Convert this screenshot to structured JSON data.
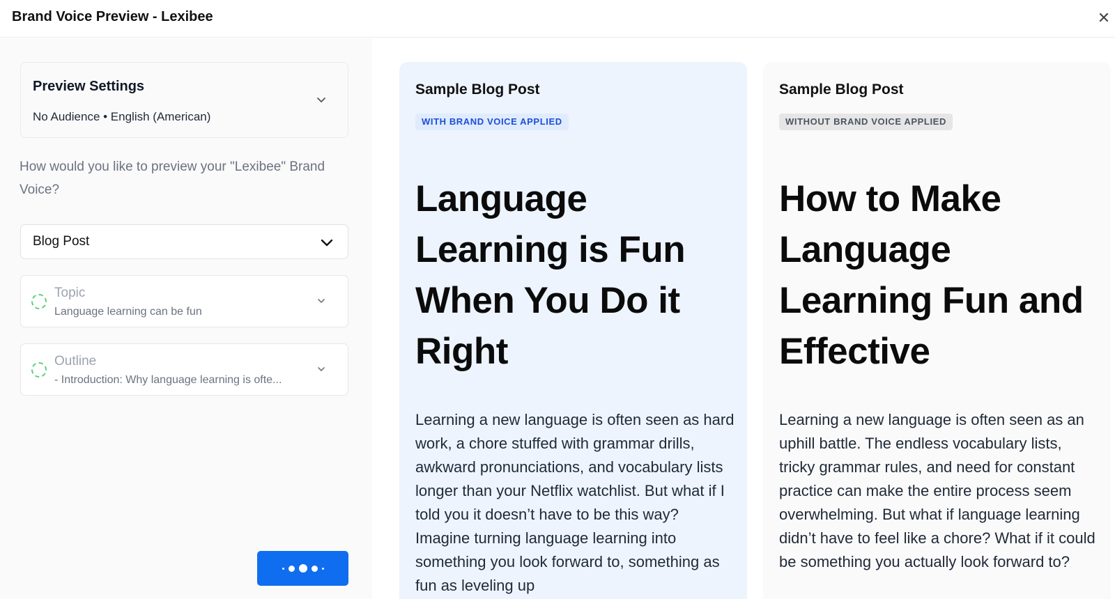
{
  "window": {
    "title": "Brand Voice Preview - Lexibee",
    "close_icon": "close-icon"
  },
  "settings": {
    "title": "Preview Settings",
    "summary": "No Audience • English (American)",
    "chevron_icon": "chevron-down-icon"
  },
  "question": "How would you like to preview your \"Lexibee\" Brand Voice?",
  "content_type": {
    "selected": "Blog Post",
    "chevron_icon": "chevron-down-icon"
  },
  "fields": {
    "topic": {
      "label": "Topic",
      "value": "Language learning can be fun",
      "status_icon": "loading-spinner-icon"
    },
    "outline": {
      "label": "Outline",
      "value": "- Introduction: Why language learning is ofte...",
      "status_icon": "loading-spinner-icon"
    }
  },
  "generate_button": {
    "state": "loading",
    "icon": "loading-dots-icon"
  },
  "preview_with": {
    "title": "Sample Blog Post",
    "badge": "WITH BRAND VOICE APPLIED",
    "headline": "Language Learning is Fun When You Do it Right",
    "body": "Learning a new language is often seen as hard work, a chore stuffed with grammar drills, awkward pronunciations, and vocabulary lists longer than your Netflix watchlist. But what if I told you it doesn’t have to be this way? Imagine turning language learning into something you look forward to, something as fun as leveling up"
  },
  "preview_without": {
    "title": "Sample Blog Post",
    "badge": "WITHOUT BRAND VOICE APPLIED",
    "headline": "How to Make Language Learning Fun and Effective",
    "body": "Learning a new language is often seen as an uphill battle. The endless vocabulary lists, tricky grammar rules, and need for constant practice can make the entire process seem overwhelming. But what if language learning didn’t have to feel like a chore? What if it could be something you actually look forward to?"
  },
  "colors": {
    "accent": "#0f6ef0",
    "with_panel_bg": "#edf4fe",
    "with_badge_text": "#1d4ed8",
    "spinner": "#5ad07a"
  }
}
